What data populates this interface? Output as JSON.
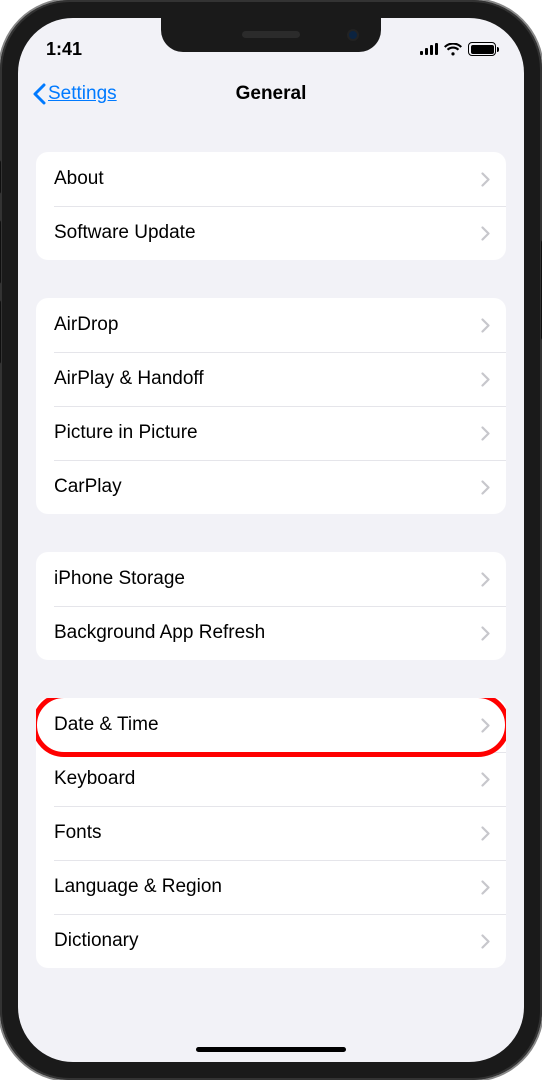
{
  "status": {
    "time": "1:41"
  },
  "nav": {
    "back": "Settings",
    "title": "General"
  },
  "groups": [
    {
      "items": [
        {
          "label": "About"
        },
        {
          "label": "Software Update"
        }
      ]
    },
    {
      "items": [
        {
          "label": "AirDrop"
        },
        {
          "label": "AirPlay & Handoff"
        },
        {
          "label": "Picture in Picture"
        },
        {
          "label": "CarPlay"
        }
      ]
    },
    {
      "items": [
        {
          "label": "iPhone Storage"
        },
        {
          "label": "Background App Refresh"
        }
      ]
    },
    {
      "items": [
        {
          "label": "Date & Time"
        },
        {
          "label": "Keyboard"
        },
        {
          "label": "Fonts"
        },
        {
          "label": "Language & Region"
        },
        {
          "label": "Dictionary"
        }
      ]
    }
  ]
}
